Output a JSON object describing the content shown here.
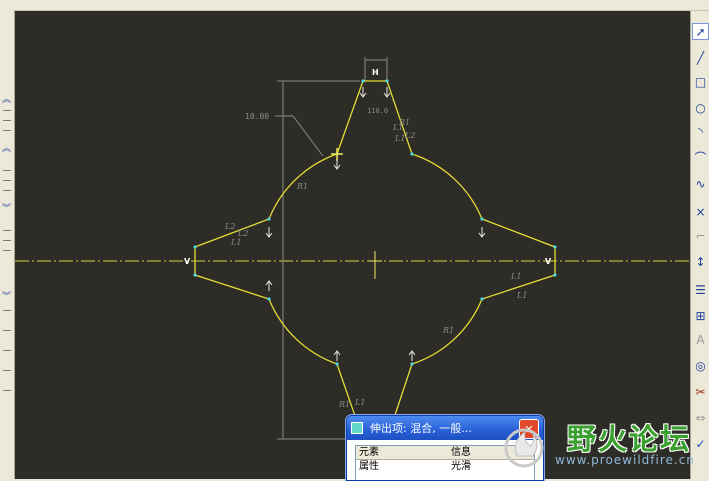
{
  "canvas": {
    "dimension_value": "10.00",
    "labels": {
      "h": "H",
      "v_left": "V",
      "v_right": "V",
      "angle": "110.0"
    },
    "constraint_syms": [
      "R1",
      "R1",
      "L2",
      "L1",
      "L2",
      "L1",
      "L1",
      "L1",
      "L1",
      "R1",
      "R1",
      "L1",
      "L2"
    ]
  },
  "dialog": {
    "title": "伸出项: 混合, 一般...",
    "close_label": "✕",
    "columns": [
      "元素",
      "信息"
    ],
    "rows": [
      {
        "element": "属性",
        "info": "光滑"
      }
    ]
  },
  "watermark": {
    "text": "野火论坛",
    "url": "www.proewildfire.cn"
  },
  "toolbar": {
    "icons": [
      "select-arrow-icon",
      "line-icon",
      "rectangle-icon",
      "circle-icon",
      "arc-icon",
      "fillet-icon",
      "spline-icon",
      "point-icon",
      "axis-icon",
      "dimension-icon",
      "modify-icon",
      "constraint-icon",
      "text-icon",
      "palette-icon",
      "trim-icon",
      "mirror-icon",
      "done-check-icon"
    ]
  }
}
